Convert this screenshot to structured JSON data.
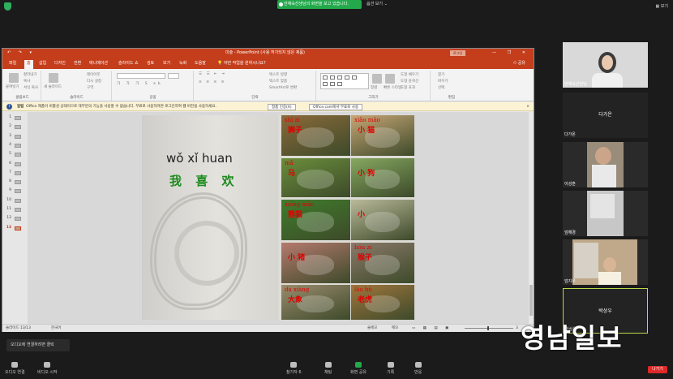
{
  "zoom": {
    "share_banner": "안재숙선생님의 화면을 보고 있습니다.",
    "view_options": "옵션 보기 ⌄",
    "gallery_view": "보기"
  },
  "ppt": {
    "title": "미술 - PowerPoint (사용 허가되지 않은 제품)",
    "login_button": "로그인",
    "quick_access": "↶ ↷ ▾",
    "window_controls": "— ❐ ✕",
    "tabs": [
      "파일",
      "홈",
      "삽입",
      "디자인",
      "전환",
      "애니메이션",
      "슬라이드 쇼",
      "검토",
      "보기",
      "녹화",
      "도움말"
    ],
    "tell_me": "어떤 작업을 원하시나요?",
    "share": "공유",
    "ribbon_groups": [
      "클립보드",
      "슬라이드",
      "글꼴",
      "단락",
      "그리기",
      "편집"
    ],
    "ribbon_items": {
      "paste": "붙여넣기",
      "cut": "잘라내기",
      "copy": "복사",
      "format_painter": "서식 복사",
      "new_slide": "새 슬라이드",
      "layout": "레이아웃",
      "reset": "다시 설정",
      "section": "구역",
      "text_direction": "텍스트 방향",
      "align_text": "텍스트 맞춤",
      "smartart": "SmartArt로 변환",
      "arrange": "정렬",
      "quick_styles": "빠른 스타일",
      "shape_fill": "도형 채우기",
      "shape_outline": "도형 윤곽선",
      "shape_effects": "도형 효과",
      "find": "찾기",
      "replace": "바꾸기",
      "select": "선택"
    },
    "notification": {
      "label": "알림",
      "message": "Office 제품이 비활성 상태이므로 대부분의 기능을 사용할 수 없습니다. 무료로 사용하려면 로그인하여 웹 버전을 사용하세요.",
      "activate_button": "정품 인증(A)",
      "web_button": "Office.com에서 무료로 사용",
      "close": "×"
    },
    "slide_numbers": [
      "1",
      "2",
      "3",
      "4",
      "5",
      "6",
      "7",
      "8",
      "9",
      "10",
      "11",
      "12",
      "13"
    ],
    "selected_slide": "13",
    "slide": {
      "pinyin_line": "wǒ  xǐ huan",
      "hanzi_line": "我 喜 欢",
      "cells": [
        {
          "pinyin": "shī zi",
          "hanzi": "狮子",
          "bg": "#8b6a3a"
        },
        {
          "pinyin": "xiǎo māo",
          "hanzi": "小 猫",
          "bg": "#c7a676"
        },
        {
          "pinyin": "mǎ",
          "hanzi": "马",
          "bg": "#6a8e3b"
        },
        {
          "pinyin": "",
          "hanzi": "小 狗",
          "bg": "#86a860"
        },
        {
          "pinyin": "xióng māo",
          "hanzi": "熊猫",
          "bg": "#3f7d2b"
        },
        {
          "pinyin": "",
          "hanzi": "小",
          "bg": "#b9ba9a"
        },
        {
          "pinyin": "",
          "hanzi": "小 猪",
          "bg": "#b57a6e"
        },
        {
          "pinyin": "hóu zi",
          "hanzi": "猴子",
          "bg": "#8b7a6a"
        },
        {
          "pinyin": "dà xiàng",
          "hanzi": "大象",
          "bg": "#9b8c6e"
        },
        {
          "pinyin": "lǎo hǔ",
          "hanzi": "老虎",
          "bg": "#a0763d"
        }
      ]
    },
    "status": {
      "slide_indicator": "슬라이드 13/13",
      "language": "한국어",
      "notes": "슬메모",
      "comments": "메모",
      "zoom_level": "3"
    }
  },
  "participants": [
    {
      "name": "안재숙선생님",
      "camera": true,
      "bg": "#d9d9d9"
    },
    {
      "name": "다가온",
      "camera": false,
      "center": "다가온"
    },
    {
      "name": "이성훈",
      "camera": true,
      "bg": "#9a8c7a"
    },
    {
      "name": "엄해경",
      "camera": true,
      "bg": "#c7c7c7"
    },
    {
      "name": "엄지우",
      "camera": true,
      "bg": "#bfa98a"
    },
    {
      "name": "박상우",
      "camera": false,
      "center": "박상우"
    }
  ],
  "bottom": {
    "audio_tooltip": "오디오에 연결하려면 클릭",
    "audio": "오디오 연결",
    "video": "비디오 시작",
    "participants": "참가자",
    "participants_count": "6",
    "chat": "채팅",
    "share_screen": "화면 공유",
    "record": "기록",
    "reactions": "반응",
    "leave": "나가기"
  },
  "watermark": "영남일보"
}
